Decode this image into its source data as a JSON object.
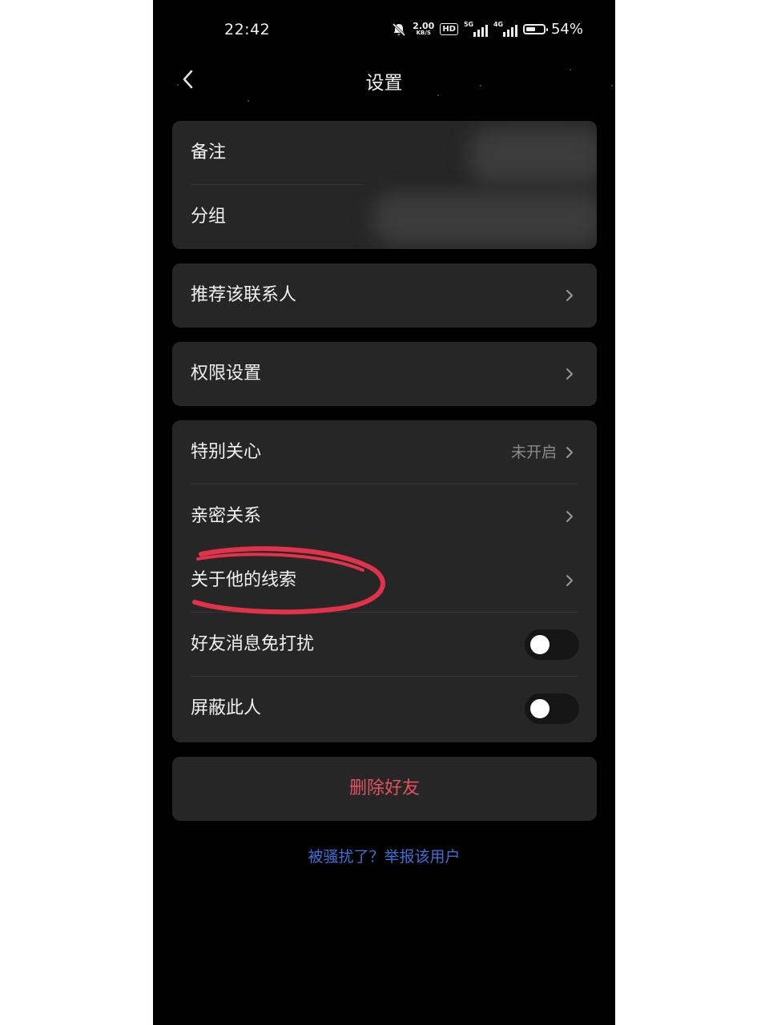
{
  "status": {
    "time": "22:42",
    "speed_value": "2.00",
    "speed_unit": "KB/S",
    "hd_label": "HD",
    "net1_label": "5G",
    "net2_label": "4G",
    "battery_percent": "54%",
    "battery_level": 0.54
  },
  "header": {
    "title": "设置"
  },
  "group1": {
    "remark_label": "备注",
    "group_label": "分组"
  },
  "recommend": {
    "label": "推荐该联系人"
  },
  "permissions": {
    "label": "权限设置"
  },
  "group3": {
    "special_care_label": "特别关心",
    "special_care_value": "未开启",
    "intimate_label": "亲密关系",
    "clues_label": "关于他的线索",
    "mute_label": "好友消息免打扰",
    "mute_on": false,
    "block_label": "屏蔽此人",
    "block_on": false
  },
  "delete_label": "删除好友",
  "report_link": "被骚扰了？举报该用户",
  "colors": {
    "background": "#000000",
    "card": "#262626",
    "delete_text": "#e3525f",
    "link": "#3d6fd6",
    "annotation": "#e0334a"
  }
}
